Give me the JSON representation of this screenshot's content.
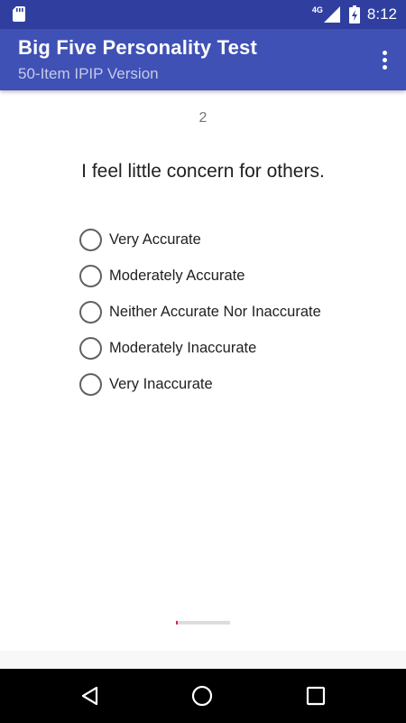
{
  "status_bar": {
    "network": "4G",
    "time": "8:12",
    "icons": [
      "sd-card-icon",
      "signal-icon",
      "battery-charging-icon"
    ]
  },
  "app_bar": {
    "title": "Big Five Personality Test",
    "subtitle": "50-Item IPIP Version",
    "menu_icon": "overflow-menu-icon"
  },
  "question": {
    "number": "2",
    "text": "I feel little concern for others.",
    "options": [
      "Very Accurate",
      "Moderately Accurate",
      "Neither Accurate Nor Inaccurate",
      "Moderately Inaccurate",
      "Very Inaccurate"
    ],
    "selected": null
  },
  "progress": {
    "fraction": 0.04
  },
  "nav_bar": {
    "icons": [
      "back-icon",
      "home-icon",
      "recents-icon"
    ]
  },
  "colors": {
    "status_bar": "#303F9F",
    "app_bar": "#3F51B5",
    "accent": "#E91E63",
    "radio_border": "#616161",
    "nav_bar": "#000000"
  }
}
